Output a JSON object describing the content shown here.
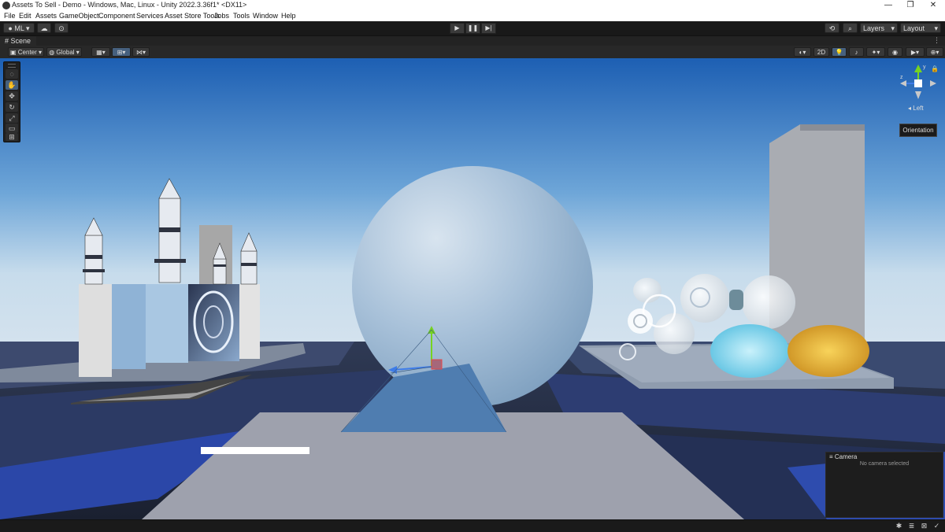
{
  "window": {
    "title": "Assets To Sell - Demo - Windows, Mac, Linux - Unity 2022.3.36f1* <DX11>",
    "controls": [
      "—",
      "❐",
      "✕"
    ]
  },
  "menu": [
    "File",
    "Edit",
    "Assets",
    "GameObject",
    "Component",
    "Services",
    "Asset Store Tools",
    "Jobs",
    "Tools",
    "Window",
    "Help"
  ],
  "toolbar": {
    "account_label": "ML",
    "layers_label": "Layers",
    "layout_label": "Layout",
    "play_icons": [
      "▶",
      "❚❚",
      "▶|"
    ]
  },
  "scene_tab": {
    "label": "Scene",
    "more": "⋮"
  },
  "scene_toolbar": {
    "pivot_label": "Center",
    "space_label": "Global",
    "mode_2d": "2D"
  },
  "gizmo": {
    "view_label": "Left",
    "axis_labels": [
      "y",
      "z"
    ],
    "tooltip": "Orientation"
  },
  "camera_overlay": {
    "title": "Camera",
    "empty_text": "No camera selected"
  },
  "colors": {
    "sky_top": "#1d5fb3",
    "sky_horizon": "#c7dcec",
    "sphere": "#97b2cc",
    "gizmo_y": "#76d321",
    "gizmo_z": "#3e7ce8",
    "gizmo_x": "#e24a4a"
  }
}
